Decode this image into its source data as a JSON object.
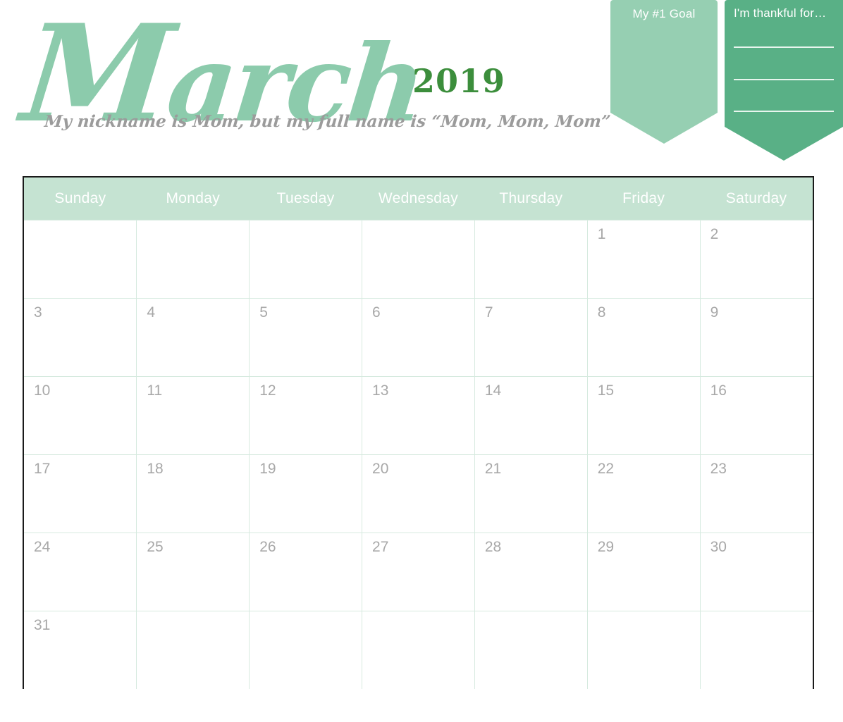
{
  "header": {
    "month": "March",
    "year": "2019",
    "quote": "My nickname is Mom, but my full name is  “Mom, Mom, Mom”"
  },
  "ribbons": {
    "goal": {
      "label": "My #1 Goal",
      "color": "#96CFB2"
    },
    "thankful": {
      "label": "I'm thankful for…",
      "color": "#59B086",
      "line_count": 3
    }
  },
  "colors": {
    "month_script": "#8CCBAC",
    "year_green": "#3C8E3C",
    "quote_gray": "#9B9B9B",
    "header_row": "#C5E3D2",
    "grid_line": "#D6EADF",
    "outer_border": "#1A1A1A",
    "daynum_gray": "#A8A8A8"
  },
  "calendar": {
    "weekdays": [
      "Sunday",
      "Monday",
      "Tuesday",
      "Wednesday",
      "Thursday",
      "Friday",
      "Saturday"
    ],
    "weeks": [
      [
        "",
        "",
        "",
        "",
        "",
        "1",
        "2"
      ],
      [
        "3",
        "4",
        "5",
        "6",
        "7",
        "8",
        "9"
      ],
      [
        "10",
        "11",
        "12",
        "13",
        "14",
        "15",
        "16"
      ],
      [
        "17",
        "18",
        "19",
        "20",
        "21",
        "22",
        "23"
      ],
      [
        "24",
        "25",
        "26",
        "27",
        "28",
        "29",
        "30"
      ],
      [
        "31",
        "",
        "",
        "",
        "",
        "",
        ""
      ]
    ]
  }
}
